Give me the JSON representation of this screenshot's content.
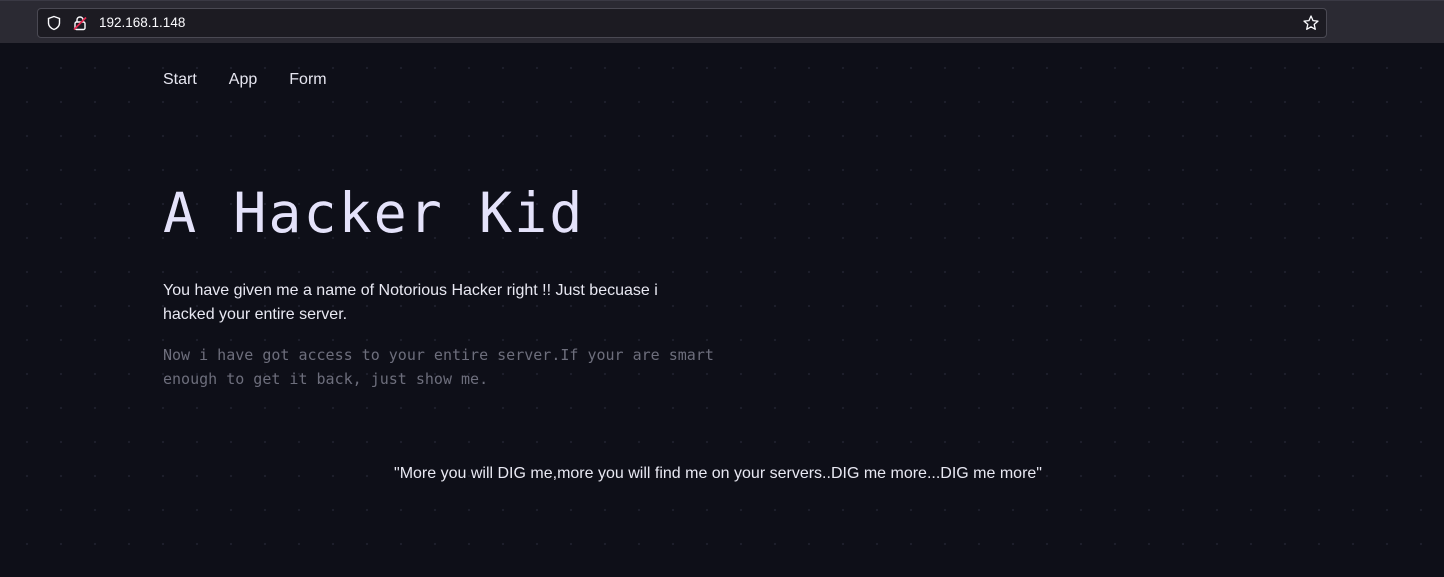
{
  "browser": {
    "url": "192.168.1.148",
    "icons": [
      "shield-icon",
      "insecure-lock-icon",
      "bookmark-star-icon"
    ]
  },
  "nav": {
    "items": [
      {
        "label": "Start"
      },
      {
        "label": "App"
      },
      {
        "label": "Form"
      }
    ]
  },
  "hero": {
    "title": "A Hacker Kid",
    "intro": "You have given me a name of Notorious Hacker right !! Just becuase i hacked your entire server.",
    "mono": "Now i have got access to your entire server.If your are smart enough to get it back, just show me."
  },
  "quote": "\"More you will DIG me,more you will find me on your servers..DIG me more...DIG me more\"",
  "colors": {
    "background": "#0e0f18",
    "browser_bar": "#2b2a33",
    "title": "#e4e2fa",
    "muted_text": "#6d6e7c",
    "insecure_red": "#e22850"
  }
}
